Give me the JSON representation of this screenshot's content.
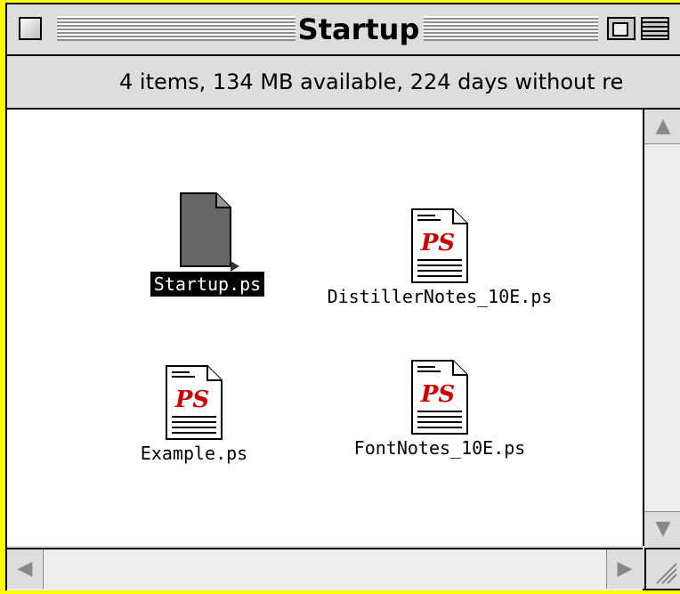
{
  "window": {
    "title": "Startup",
    "info": "4 items, 134 MB available, 224 days without re"
  },
  "items": [
    {
      "label": "Startup.ps",
      "icon": "generic-document-icon",
      "selected": true
    },
    {
      "label": "DistillerNotes_10E.ps",
      "icon": "postscript-file-icon",
      "selected": false
    },
    {
      "label": "Example.ps",
      "icon": "postscript-file-icon",
      "selected": false
    },
    {
      "label": "FontNotes_10E.ps",
      "icon": "postscript-file-icon",
      "selected": false
    }
  ],
  "ps_badge": "PS",
  "colors": {
    "desktop": "#ffff00",
    "ps_red": "#cc0000"
  }
}
